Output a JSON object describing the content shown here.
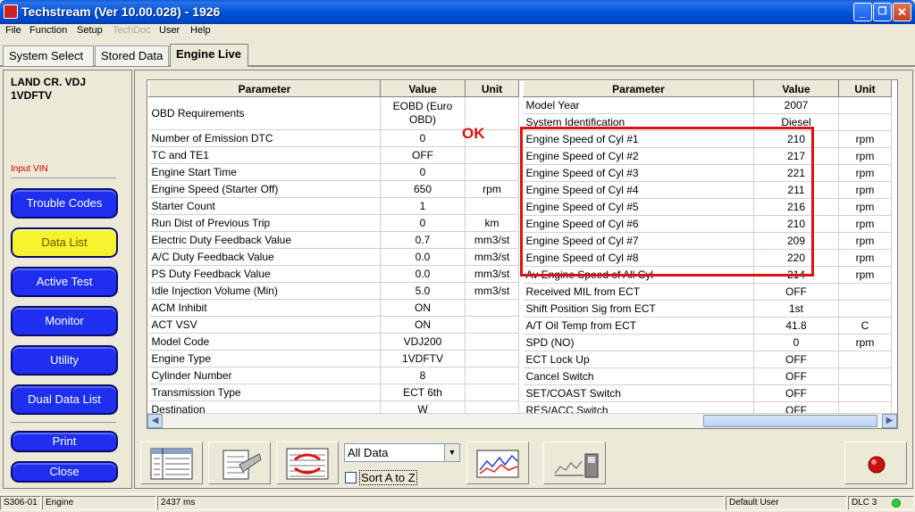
{
  "window": {
    "title": "Techstream (Ver 10.00.028) - 1926",
    "minimize": "_",
    "maximize": "❐",
    "close": "✕"
  },
  "menu": [
    "File",
    "Function",
    "Setup",
    "TechDoc",
    "User",
    "Help"
  ],
  "tabs": [
    "System Select",
    "Stored Data",
    "Engine Live"
  ],
  "sidebar": {
    "vehicle_line1": "LAND CR. VDJ",
    "vehicle_line2": "1VDFTV",
    "input_vin": "Input VIN",
    "buttons": [
      "Trouble Codes",
      "Data List",
      "Active Test",
      "Monitor",
      "Utility",
      "Dual Data List",
      "Print",
      "Close"
    ]
  },
  "table": {
    "headers": [
      "Parameter",
      "Value",
      "Unit"
    ],
    "left_rows": [
      [
        "OBD Requirements",
        "EOBD (Euro OBD)",
        ""
      ],
      [
        "Number of Emission DTC",
        "0",
        ""
      ],
      [
        "TC and TE1",
        "OFF",
        ""
      ],
      [
        "Engine Start Time",
        "0",
        ""
      ],
      [
        "Engine Speed (Starter Off)",
        "650",
        "rpm"
      ],
      [
        "Starter Count",
        "1",
        ""
      ],
      [
        "Run Dist of Previous Trip",
        "0",
        "km"
      ],
      [
        "Electric Duty Feedback Value",
        "0.7",
        "mm3/st"
      ],
      [
        "A/C Duty Feedback Value",
        "0.0",
        "mm3/st"
      ],
      [
        "PS Duty Feedback Value",
        "0.0",
        "mm3/st"
      ],
      [
        "Idle Injection Volume (Min)",
        "5.0",
        "mm3/st"
      ],
      [
        "ACM Inhibit",
        "ON",
        ""
      ],
      [
        "ACT VSV",
        "ON",
        ""
      ],
      [
        "Model Code",
        "VDJ200",
        ""
      ],
      [
        "Engine Type",
        "1VDFTV",
        ""
      ],
      [
        "Cylinder Number",
        "8",
        ""
      ],
      [
        "Transmission Type",
        "ECT 6th",
        ""
      ],
      [
        "Destination",
        "W",
        ""
      ]
    ],
    "right_rows": [
      [
        "Model Year",
        "2007",
        ""
      ],
      [
        "System Identification",
        "Diesel",
        ""
      ],
      [
        "Engine Speed of Cyl #1",
        "210",
        "rpm"
      ],
      [
        "Engine Speed of Cyl #2",
        "217",
        "rpm"
      ],
      [
        "Engine Speed of Cyl #3",
        "221",
        "rpm"
      ],
      [
        "Engine Speed of Cyl #4",
        "211",
        "rpm"
      ],
      [
        "Engine Speed of Cyl #5",
        "216",
        "rpm"
      ],
      [
        "Engine Speed of Cyl #6",
        "210",
        "rpm"
      ],
      [
        "Engine Speed of Cyl #7",
        "209",
        "rpm"
      ],
      [
        "Engine Speed of Cyl #8",
        "220",
        "rpm"
      ],
      [
        "Av Engine Speed of All Cyl",
        "214",
        "rpm"
      ],
      [
        "Received MIL from ECT",
        "OFF",
        ""
      ],
      [
        "Shift Position Sig from ECT",
        "1st",
        ""
      ],
      [
        "A/T Oil Temp from ECT",
        "41.8",
        "C"
      ],
      [
        "SPD (NO)",
        "0",
        "rpm"
      ],
      [
        "ECT Lock Up",
        "OFF",
        ""
      ],
      [
        "Cancel Switch",
        "OFF",
        ""
      ],
      [
        "SET/COAST Switch",
        "OFF",
        ""
      ],
      [
        "RES/ACC Switch",
        "OFF",
        ""
      ]
    ]
  },
  "annotation": {
    "ok": "OK"
  },
  "toolbar": {
    "filter_select": "All Data",
    "sort_label": "Sort A to Z"
  },
  "status": {
    "code": "S306-01",
    "system": "Engine",
    "interval": "2437 ms",
    "user": "Default User",
    "connection": "DLC 3"
  },
  "colors": {
    "title_blue": "#0053d9",
    "nav_blue": "#1e2ff0",
    "nav_active_yellow": "#f5f22e",
    "highlight_red": "#dd1111",
    "status_green": "#2ed12e"
  }
}
